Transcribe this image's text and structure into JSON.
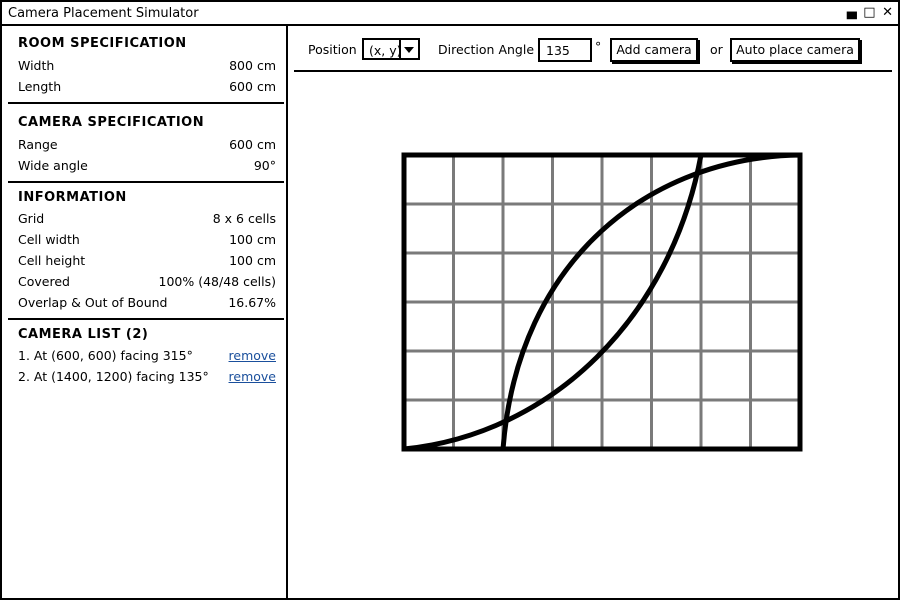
{
  "app": {
    "title": "Camera Placement Simulator",
    "controls": {
      "minimize": "▄",
      "maximize": "□",
      "close": "✕"
    }
  },
  "room": {
    "heading": "ROOM SPECIFICATION",
    "width_label": "Width",
    "width_value": "800 cm",
    "length_label": "Length",
    "length_value": "600 cm"
  },
  "camera_spec": {
    "heading": "CAMERA SPECIFICATION",
    "range_label": "Range",
    "range_value": "600 cm",
    "angle_label": "Wide angle",
    "angle_value": "90°"
  },
  "info": {
    "heading": "INFORMATION",
    "rows": [
      {
        "label": "Grid",
        "value": "8 x 6 cells"
      },
      {
        "label": "Cell width",
        "value": "100 cm"
      },
      {
        "label": "Cell height",
        "value": "100 cm"
      },
      {
        "label": "Covered",
        "value": "100% (48/48 cells)"
      },
      {
        "label": "Overlap & Out of Bound",
        "value": "16.67%"
      }
    ]
  },
  "camera_list": {
    "heading": "CAMERA LIST (2)",
    "remove_label": "remove",
    "items": [
      {
        "text": "1. At (600, 600) facing 315°"
      },
      {
        "text": "2. At (1400, 1200) facing 135°"
      }
    ]
  },
  "toolbar": {
    "position_label": "Position",
    "position_value": "(x, y)",
    "angle_label": "Direction Angle",
    "angle_value": "135",
    "degree_symbol": "°",
    "add_button": "Add camera",
    "or_text": "or",
    "auto_button": "Auto place camera"
  },
  "plan": {
    "grid_cols": 8,
    "grid_rows": 6,
    "cell_cm": 100,
    "room_cm": [
      800,
      600
    ],
    "line_color": "#000000",
    "grid_color": "#7a7a7a"
  }
}
